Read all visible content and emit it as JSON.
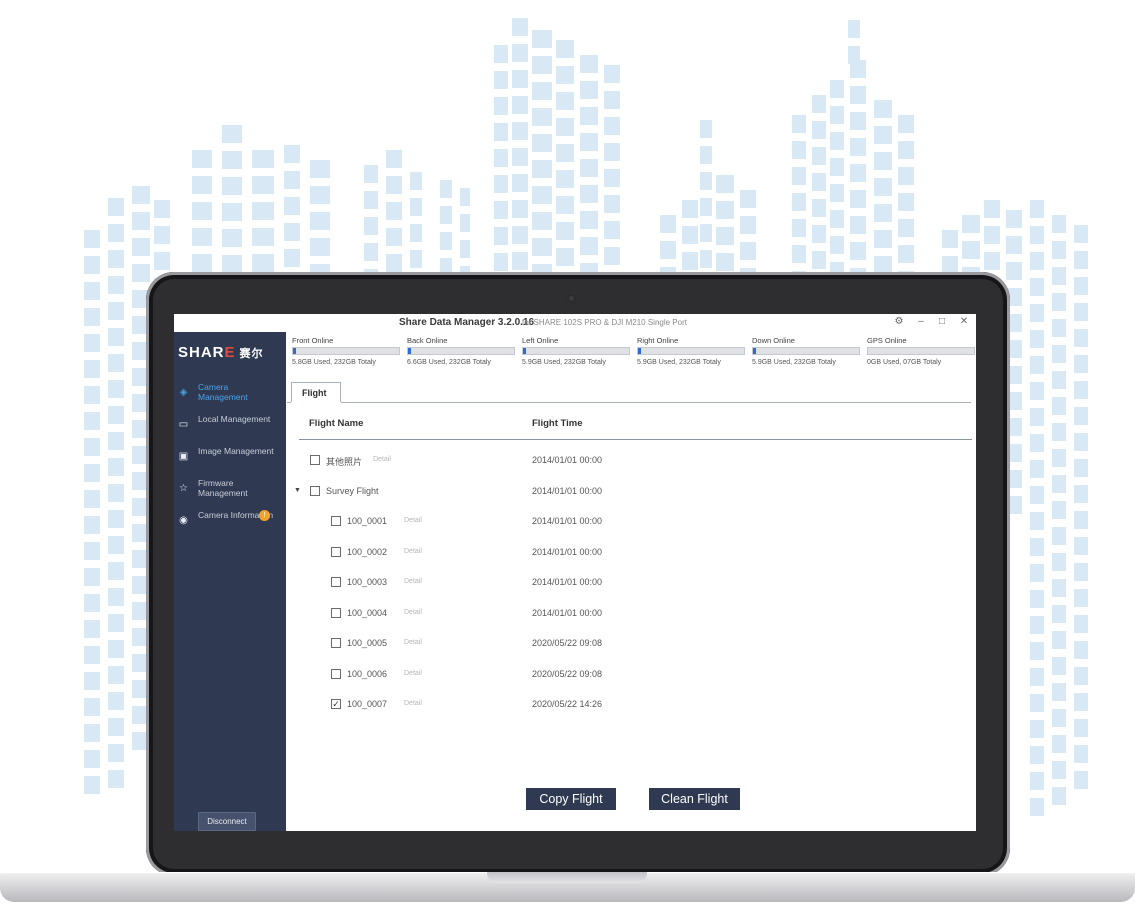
{
  "window": {
    "title": "Share Data Manager 3.2.0.16",
    "subtitle": "for SHARE 102S PRO & DJI M210 Single Port",
    "controls": [
      "options",
      "minimize",
      "maximize",
      "close"
    ]
  },
  "brand": {
    "logo_pre": "SHAR",
    "logo_e": "E",
    "logo_cn": "赛尔"
  },
  "sidebar": {
    "items": [
      {
        "label": "Camera Management",
        "icon": "cube-icon",
        "active": true
      },
      {
        "label": "Local Management",
        "icon": "folder-icon",
        "active": false
      },
      {
        "label": "Image Management",
        "icon": "image-icon",
        "active": false
      },
      {
        "label": "Firmware Management",
        "icon": "star-icon",
        "active": false
      },
      {
        "label": "Camera Information",
        "icon": "info-circle-icon",
        "active": false,
        "badge": "!"
      }
    ],
    "disconnect_label": "Disconnect"
  },
  "cameras": [
    {
      "name": "Front Online",
      "usage": "5.8GB Used, 232GB Totaly",
      "fill": 0.025
    },
    {
      "name": "Back Online",
      "usage": "6.6GB Used, 232GB Totaly",
      "fill": 0.028
    },
    {
      "name": "Left Online",
      "usage": "5.9GB Used, 232GB Totaly",
      "fill": 0.025
    },
    {
      "name": "Right Online",
      "usage": "5.9GB Used, 232GB Totaly",
      "fill": 0.025
    },
    {
      "name": "Down Online",
      "usage": "5.9GB Used, 232GB Totaly",
      "fill": 0.025
    },
    {
      "name": "GPS Online",
      "usage": "0GB Used, 07GB Totaly",
      "fill": 0
    }
  ],
  "tab": {
    "label": "Flight"
  },
  "table": {
    "headers": {
      "name": "Flight Name",
      "time": "Flight Time"
    },
    "detail_label": "Detail",
    "rows": [
      {
        "name": "其他照片",
        "time": "2014/01/01 00:00",
        "checked": false,
        "detail": true,
        "level": 0,
        "expandable": false
      },
      {
        "name": "Survey Flight",
        "time": "2014/01/01 00:00",
        "checked": false,
        "detail": false,
        "level": 0,
        "expandable": true
      },
      {
        "name": "100_0001",
        "time": "2014/01/01 00:00",
        "checked": false,
        "detail": true,
        "level": 1,
        "expandable": false
      },
      {
        "name": "100_0002",
        "time": "2014/01/01 00:00",
        "checked": false,
        "detail": true,
        "level": 1,
        "expandable": false
      },
      {
        "name": "100_0003",
        "time": "2014/01/01 00:00",
        "checked": false,
        "detail": true,
        "level": 1,
        "expandable": false
      },
      {
        "name": "100_0004",
        "time": "2014/01/01 00:00",
        "checked": false,
        "detail": true,
        "level": 1,
        "expandable": false
      },
      {
        "name": "100_0005",
        "time": "2020/05/22 09:08",
        "checked": false,
        "detail": true,
        "level": 1,
        "expandable": false
      },
      {
        "name": "100_0006",
        "time": "2020/05/22 09:08",
        "checked": false,
        "detail": true,
        "level": 1,
        "expandable": false
      },
      {
        "name": "100_0007",
        "time": "2020/05/22 14:26",
        "checked": true,
        "detail": true,
        "level": 1,
        "expandable": false
      }
    ]
  },
  "actions": {
    "copy_label": "Copy Flight",
    "clean_label": "Clean Flight"
  },
  "colors": {
    "sidebar": "#2f3a52",
    "accent": "#4aa3e8",
    "button": "#2f3a52",
    "background_art": "#d8e8f4"
  }
}
